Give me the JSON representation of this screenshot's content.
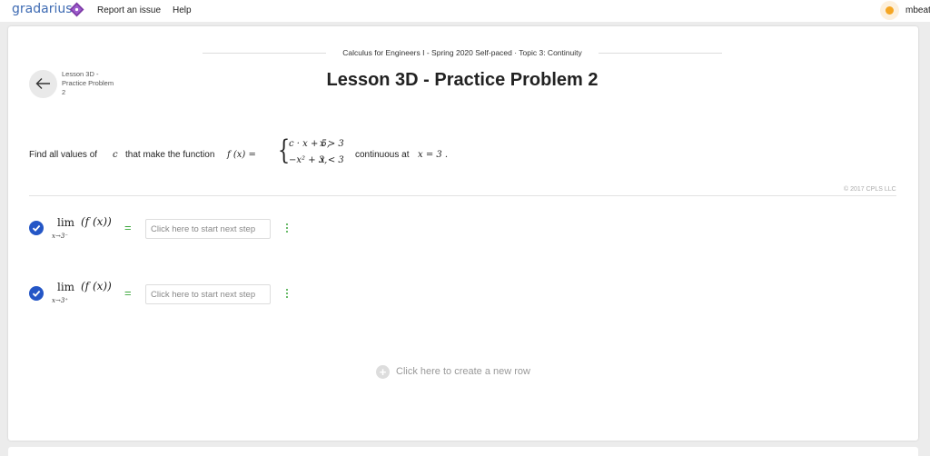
{
  "topbar": {
    "logo": "gradarius",
    "links": [
      "Report an issue",
      "Help"
    ],
    "user": "mbeat"
  },
  "lesson": {
    "breadcrumb": "Calculus for Engineers I - Spring 2020 Self-paced · Topic 3: Continuity",
    "back_label": "Lesson 3D - Practice Problem 2",
    "title": "Lesson 3D - Practice Problem 2"
  },
  "problem": {
    "prefix": "Find all values of",
    "var": "c",
    "mid": "that make the function",
    "func": "f (x) =",
    "case1_expr": "c · x + 5,",
    "case1_cond": "x > 3",
    "case2_expr": "−x² + 3,",
    "case2_cond": "x < 3",
    "suffix": "continuous at",
    "point": "x = 3 .",
    "copyright": "© 2017 CPLS LLC"
  },
  "steps": [
    {
      "lim": "lim",
      "expr": "(f (x))",
      "sub": "x→3⁻",
      "eq": "=",
      "placeholder": "Click here to start next step",
      "completed": true
    },
    {
      "lim": "lim",
      "expr": "(f (x))",
      "sub": "x→3⁺",
      "eq": "=",
      "placeholder": "Click here to start next step",
      "completed": true
    }
  ],
  "new_row": {
    "icon": "plus-icon",
    "label": "Click here to create a new row"
  },
  "colors": {
    "brand": "#3e6bb3",
    "check": "#2456c6",
    "accent_green": "#3aa63a",
    "notification": "#f5a623"
  }
}
